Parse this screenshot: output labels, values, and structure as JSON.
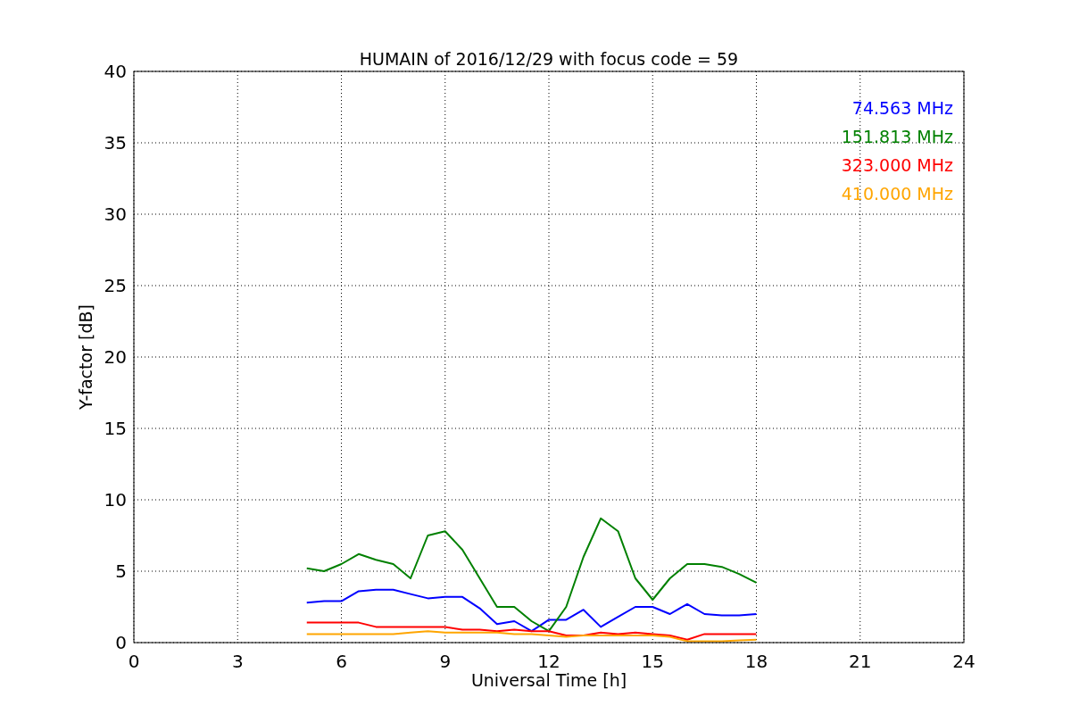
{
  "chart_data": {
    "type": "line",
    "title": "HUMAIN of 2016/12/29 with focus code = 59",
    "xlabel": "Universal Time [h]",
    "ylabel": "Y-factor [dB]",
    "x": [
      5,
      5.5,
      6,
      6.5,
      7,
      7.5,
      8,
      8.5,
      9,
      9.5,
      10,
      10.5,
      11,
      11.5,
      12,
      12.5,
      13,
      13.5,
      14,
      14.5,
      15,
      15.5,
      16,
      16.5,
      17,
      17.5,
      18
    ],
    "series": [
      {
        "name": "74.563 MHz",
        "color": "#0000ff",
        "values": [
          2.8,
          2.9,
          2.9,
          3.6,
          3.7,
          3.7,
          3.4,
          3.1,
          3.2,
          3.2,
          2.4,
          1.3,
          1.5,
          0.8,
          1.6,
          1.6,
          2.3,
          1.1,
          1.8,
          2.5,
          2.5,
          2.0,
          2.7,
          2.0,
          1.9,
          1.9,
          2.0
        ]
      },
      {
        "name": "151.813 MHz",
        "color": "#008000",
        "values": [
          5.2,
          5.0,
          5.5,
          6.2,
          5.8,
          5.5,
          4.5,
          7.5,
          7.8,
          6.5,
          4.5,
          2.5,
          2.5,
          1.5,
          0.8,
          2.5,
          6.0,
          8.7,
          7.8,
          4.5,
          3.0,
          4.5,
          5.5,
          5.5,
          5.3,
          4.8,
          4.2
        ]
      },
      {
        "name": "323.000 MHz",
        "color": "#ff0000",
        "values": [
          1.4,
          1.4,
          1.4,
          1.4,
          1.1,
          1.1,
          1.1,
          1.1,
          1.1,
          0.9,
          0.9,
          0.8,
          0.9,
          0.8,
          0.8,
          0.5,
          0.5,
          0.7,
          0.6,
          0.7,
          0.6,
          0.5,
          0.2,
          0.6,
          0.6,
          0.6,
          0.6
        ]
      },
      {
        "name": "410.000 MHz",
        "color": "#ffa500",
        "values": [
          0.6,
          0.6,
          0.6,
          0.6,
          0.6,
          0.6,
          0.7,
          0.8,
          0.7,
          0.7,
          0.7,
          0.7,
          0.6,
          0.6,
          0.5,
          0.4,
          0.5,
          0.5,
          0.5,
          0.5,
          0.5,
          0.4,
          0.1,
          0.1,
          0.1,
          0.15,
          0.2
        ]
      }
    ],
    "grid": true,
    "xlim": [
      0,
      24
    ],
    "ylim": [
      0,
      40
    ],
    "xticks": [
      0,
      3,
      6,
      9,
      12,
      15,
      18,
      21,
      24
    ],
    "yticks": [
      0,
      5,
      10,
      15,
      20,
      25,
      30,
      35,
      40
    ]
  }
}
